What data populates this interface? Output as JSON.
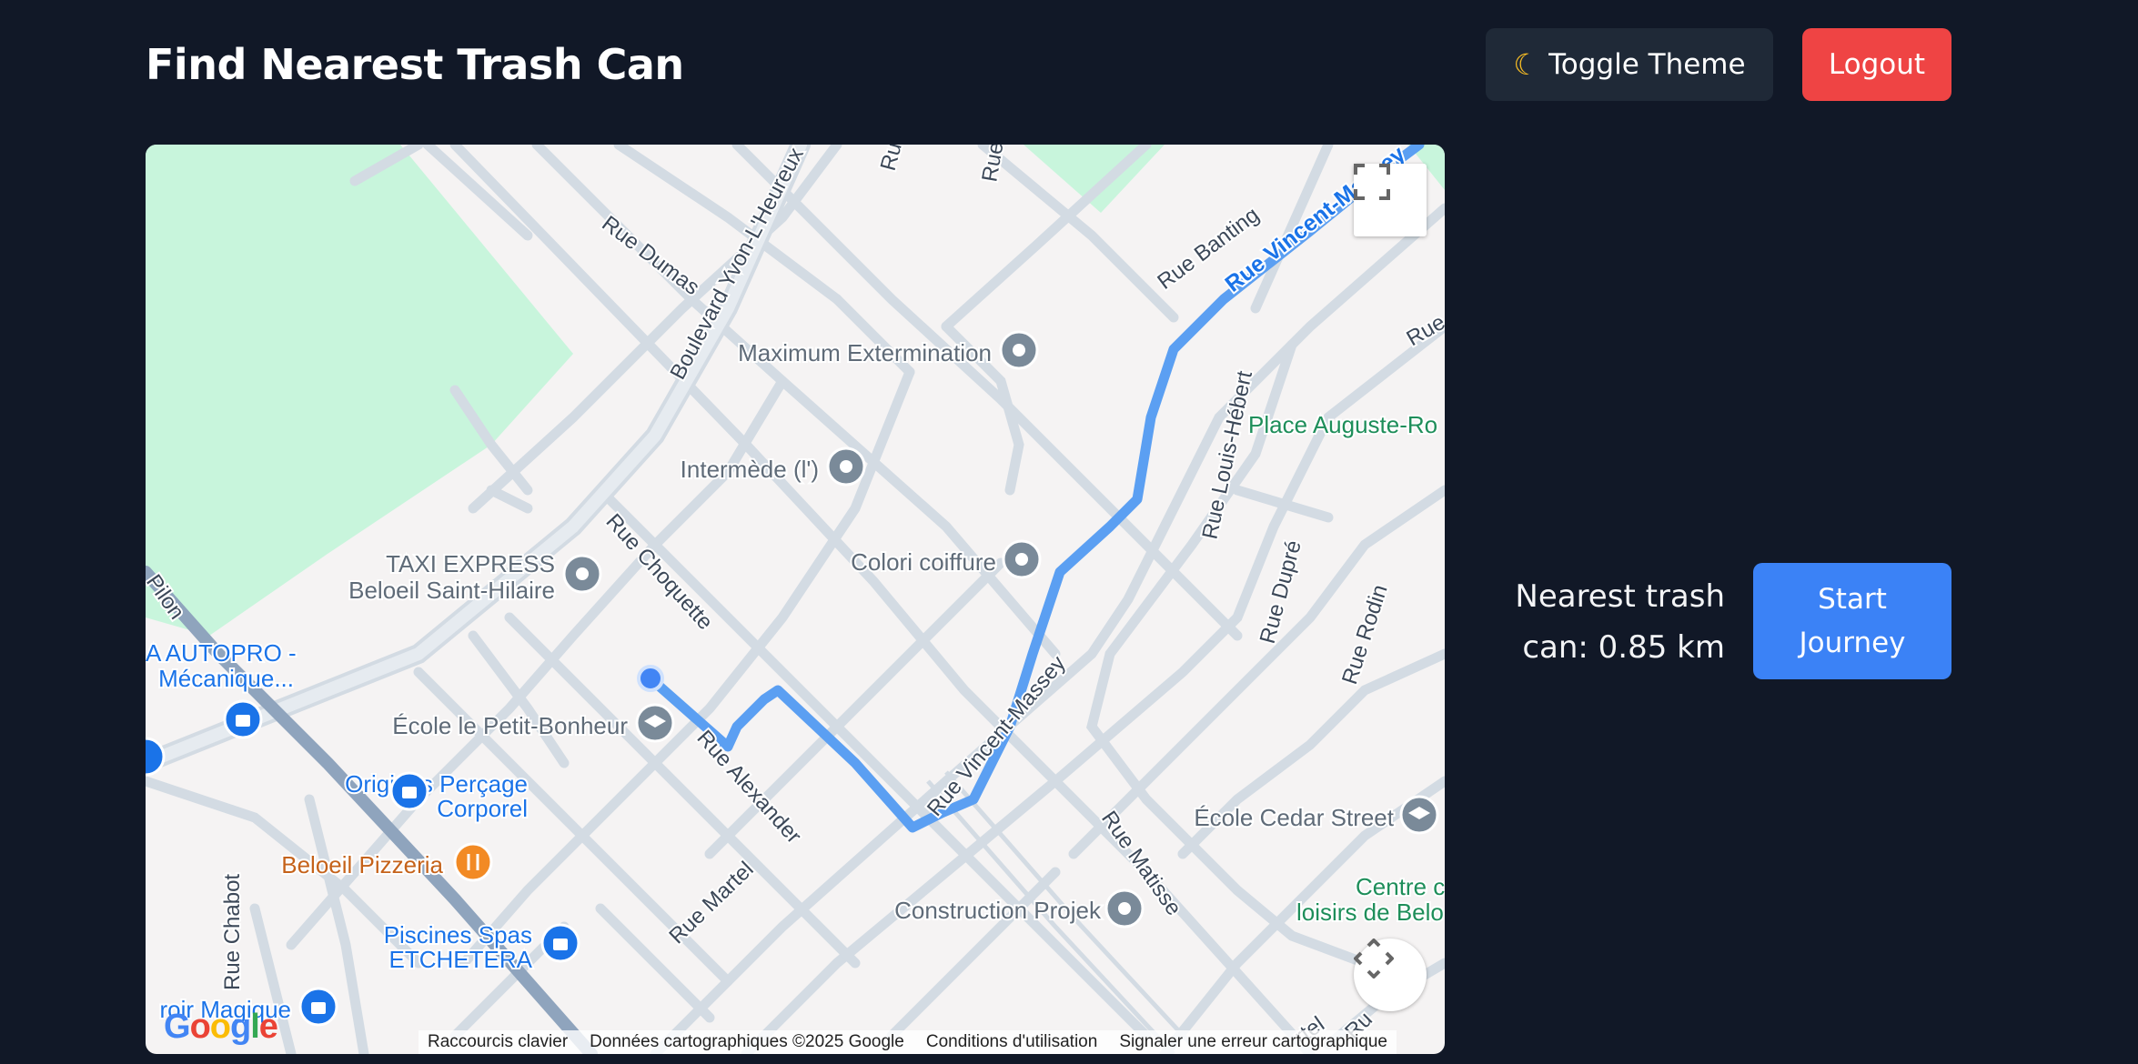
{
  "header": {
    "title": "Find Nearest Trash Can",
    "theme_label": "Toggle Theme",
    "theme_icon": "moon-icon",
    "logout_label": "Logout"
  },
  "map": {
    "pois": [
      {
        "name": "Maximum Extermination",
        "icon": "map-pin-icon"
      },
      {
        "name": "Intermède (l')",
        "icon": "map-pin-icon"
      },
      {
        "name": "Colori coiffure",
        "icon": "map-pin-icon"
      },
      {
        "name": "TAXI EXPRESS",
        "name2": "Beloeil Saint-Hilaire",
        "icon": "map-pin-icon"
      },
      {
        "name": "École le Petit-Bonheur",
        "icon": "school-icon"
      },
      {
        "name": "Construction Projek",
        "icon": "map-pin-icon"
      },
      {
        "name": "École Cedar Street",
        "icon": "school-icon"
      },
      {
        "name": "Origines Perçage",
        "name2": "Corporel",
        "icon": "shopping-bag-icon"
      },
      {
        "name": "Beloeil Pizzeria",
        "icon": "restaurant-icon"
      },
      {
        "name": "Piscines Spas",
        "name2": "ETCHETERA",
        "icon": "shopping-bag-icon"
      },
      {
        "name": "A AUTOPRO -",
        "name2": "Mécanique...",
        "icon": "shopping-bag-icon"
      },
      {
        "name": "roir Magique",
        "icon": "shopping-bag-icon"
      },
      {
        "name": "Place Auguste-Ro",
        "icon": ""
      },
      {
        "name": "Centre c",
        "name2": "loisirs de Belo",
        "icon": ""
      }
    ],
    "streets": {
      "dumas": "Rue Dumas",
      "boulevard": "Boulevard Yvon-L'Heureux",
      "choquette": "Rue Choquette",
      "alexander": "Rue Alexander",
      "martel": "Rue Martel",
      "vincent_massey": "Rue Vincent-Massey",
      "vincent_massey_top": "Rue Vincent-Massey",
      "banting": "Rue Banting",
      "louis_hebert": "Rue Louis-Hébert",
      "dupre": "Rue Dupré",
      "rodin": "Rue Rodin",
      "matisse": "Rue Matisse",
      "chabot": "Rue Chabot",
      "pilon": "Pilon",
      "rue_top1": "Rue",
      "rue_top2": "Rue",
      "rue_right": "Rue",
      "rue_bottom": "Ru",
      "martel_bottom": "rtel"
    },
    "attribution": {
      "shortcuts": "Raccourcis clavier",
      "data": "Données cartographiques ©2025 Google",
      "terms": "Conditions d'utilisation",
      "report": "Signaler une erreur cartographique"
    },
    "logo": "Google",
    "colors": {
      "route": "#5b9ff2",
      "park": "#c8f5dc",
      "road": "#d3dbe3",
      "highway": "#8fa4bd",
      "poi_gray": "#7a8a99",
      "poi_blue": "#1a73e8",
      "poi_orange": "#f28a24"
    }
  },
  "info": {
    "distance_text": "Nearest trash can: 0.85 km",
    "start_label": "Start Journey"
  }
}
